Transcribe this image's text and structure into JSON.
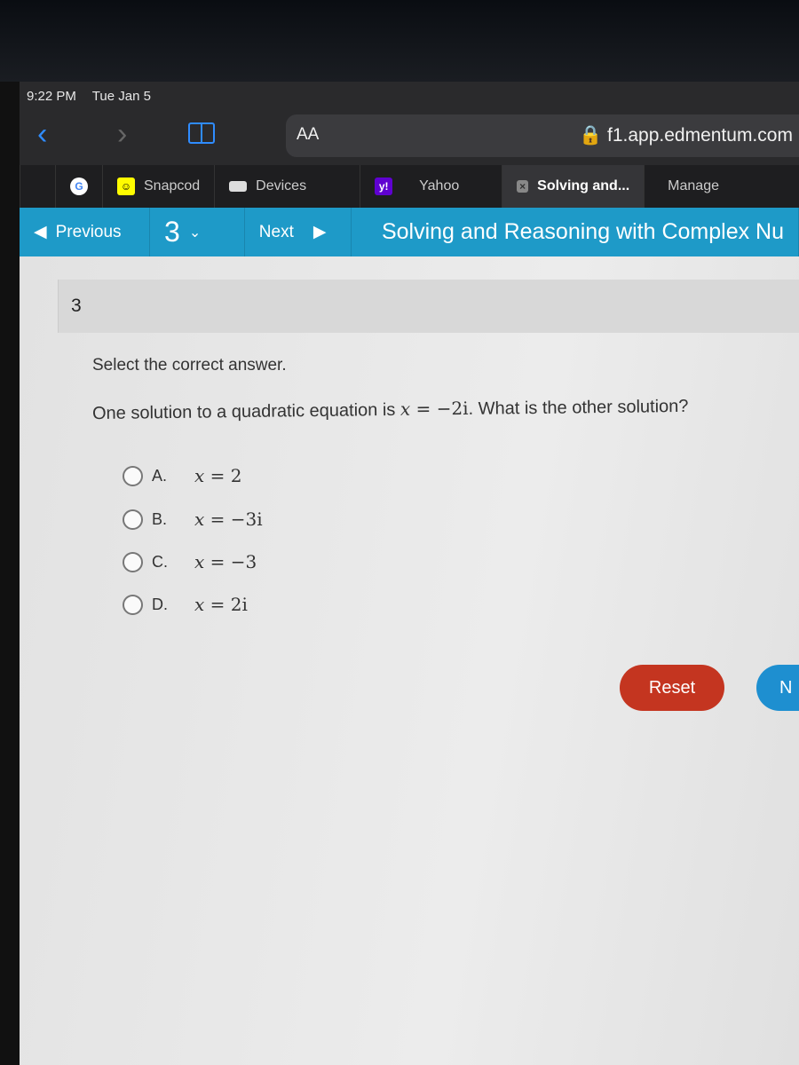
{
  "status_bar": {
    "time": "9:22 PM",
    "date": "Tue Jan 5"
  },
  "browser": {
    "text_size_label": "AA",
    "url": "f1.app.edmentum.com"
  },
  "tabs": [
    {
      "label": "",
      "icon": "google-icon"
    },
    {
      "label": "Snapcod",
      "icon": "snapchat-icon"
    },
    {
      "label": "Devices",
      "icon": "devices-icon"
    },
    {
      "label": "Yahoo",
      "icon": "yahoo-icon",
      "icon_text": "y!"
    },
    {
      "label": "Solving and...",
      "icon": "close-tab-icon",
      "active": true
    },
    {
      "label": "Manage",
      "icon": "apple-icon"
    }
  ],
  "nav": {
    "previous": "Previous",
    "question_number": "3",
    "next": "Next",
    "title": "Solving and Reasoning with Complex Nu"
  },
  "question": {
    "number": "3",
    "instruction": "Select the correct answer.",
    "text_before": "One solution to a quadratic equation is ",
    "var": "x",
    "equation_rhs": " = −2i",
    "text_after": ". What is the other solution?",
    "options": [
      {
        "label": "A.",
        "rhs": " = 2"
      },
      {
        "label": "B.",
        "rhs": " = −3i"
      },
      {
        "label": "C.",
        "rhs": " = −3"
      },
      {
        "label": "D.",
        "rhs": " = 2i"
      }
    ]
  },
  "buttons": {
    "reset": "Reset",
    "next_partial": "N"
  },
  "colors": {
    "nav_blue": "#1e9ac8",
    "reset_red": "#c43520",
    "next_blue": "#1e8fd0"
  }
}
